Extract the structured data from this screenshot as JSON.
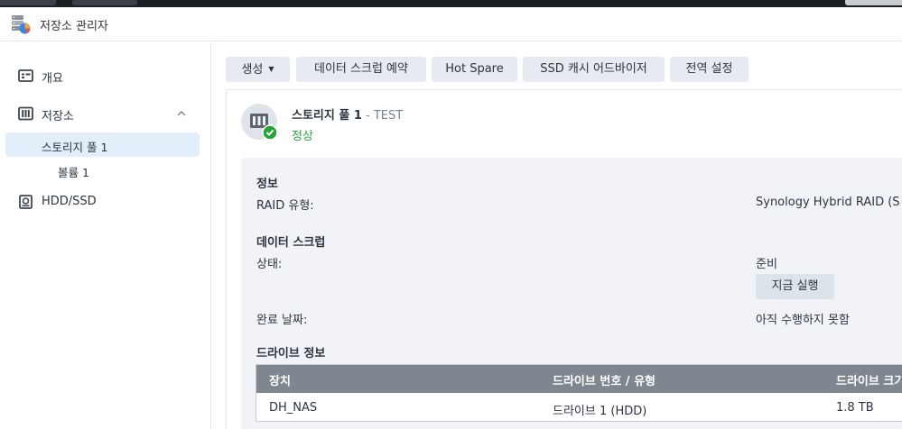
{
  "window": {
    "title": "저장소 관리자"
  },
  "sidebar": {
    "items": [
      {
        "label": "개요",
        "icon": "overview-icon"
      },
      {
        "label": "저장소",
        "icon": "storage-icon",
        "expanded": true
      },
      {
        "label": "스토리지 풀 1",
        "active": true
      },
      {
        "label": "볼륨 1"
      },
      {
        "label": "HDD/SSD",
        "icon": "disk-icon"
      }
    ]
  },
  "toolbar": {
    "create_label": "생성",
    "scrub_schedule_label": "데이터 스크럽 예약",
    "hot_spare_label": "Hot Spare",
    "ssd_cache_label": "SSD 캐시 어드바이저",
    "global_settings_label": "전역 설정"
  },
  "pool": {
    "name": "스토리지 풀 1",
    "description": "- TEST",
    "status": "정상"
  },
  "info": {
    "section_title": "정보",
    "raid_type_label": "RAID 유형:",
    "raid_type_value": "Synology Hybrid RAID (S"
  },
  "scrub": {
    "section_title": "데이터 스크럽",
    "status_label": "상태:",
    "status_value": "준비",
    "run_now_label": "지금 실행",
    "completed_label": "완료 날짜:",
    "completed_value": "아직 수행하지 못함"
  },
  "drives": {
    "section_title": "드라이브 정보",
    "columns": [
      "장치",
      "드라이브 번호 / 유형",
      "드라이브 크기"
    ],
    "rows": [
      {
        "device": "DH_NAS",
        "drive": "드라이브 1 (HDD)",
        "size": "1.8 TB"
      }
    ]
  },
  "colors": {
    "accent": "#e3eefb",
    "status_ok": "#2aa33a",
    "table_header": "#7e868f",
    "button_bg": "#e6ebf1"
  }
}
